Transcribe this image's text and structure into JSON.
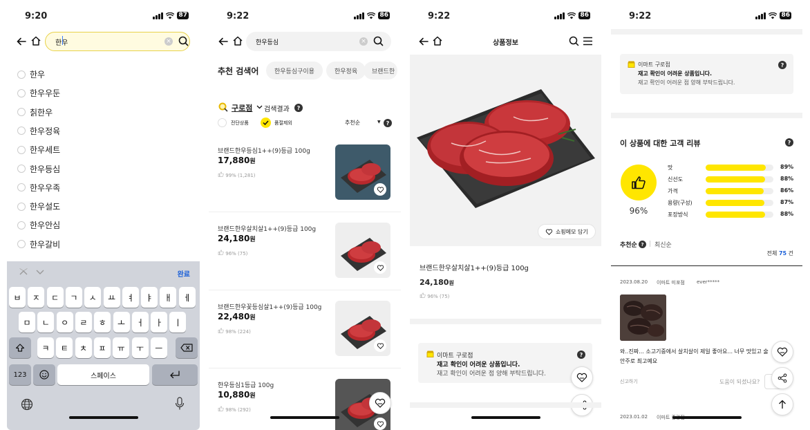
{
  "screens": [
    {
      "status": {
        "time": "9:20",
        "battery": "87"
      },
      "search": {
        "value": "한우"
      },
      "suggestions": [
        "한우",
        "한우우둔",
        "칡한우",
        "한우정육",
        "한우세트",
        "한우등심",
        "한우우족",
        "한우설도",
        "한우안심",
        "한우갈비"
      ],
      "keyboard": {
        "done": "완료",
        "row1": [
          "ㅂ",
          "ㅈ",
          "ㄷ",
          "ㄱ",
          "ㅅ",
          "ㅛ",
          "ㅕ",
          "ㅑ",
          "ㅐ",
          "ㅔ"
        ],
        "row2": [
          "ㅁ",
          "ㄴ",
          "ㅇ",
          "ㄹ",
          "ㅎ",
          "ㅗ",
          "ㅓ",
          "ㅏ",
          "ㅣ"
        ],
        "row3": [
          "ㅋ",
          "ㅌ",
          "ㅊ",
          "ㅍ",
          "ㅠ",
          "ㅜ",
          "ㅡ"
        ],
        "numbers": "123",
        "space": "스페이스"
      }
    },
    {
      "status": {
        "time": "9:22",
        "battery": "86"
      },
      "search": {
        "value": "한우등심"
      },
      "recommend_label": "추천 검색어",
      "recommend_chips": [
        "한우등심구이용",
        "한우정육",
        "브랜드한"
      ],
      "store": "구로점",
      "result_label": "검색결과",
      "filter_exclude_preorder": "전단상품",
      "filter_soldout": "품절제외",
      "sort": "추천순",
      "products": [
        {
          "name": "브랜드한우등심1++(9)등급 100g",
          "price": "17,880",
          "unit": "원",
          "rating": "99% (1,281)"
        },
        {
          "name": "브랜드한우살치살1++(9)등급 100g",
          "price": "24,180",
          "unit": "원",
          "rating": "96% (75)"
        },
        {
          "name": "브랜드한우꽃등심살1++(9)등급 100g",
          "price": "22,480",
          "unit": "원",
          "rating": "98% (224)"
        },
        {
          "name": "한우등심1등급 100g",
          "price": "10,880",
          "unit": "원",
          "rating": "98% (292)"
        }
      ]
    },
    {
      "status": {
        "time": "9:22",
        "battery": "86"
      },
      "header_title": "상품정보",
      "memo_button": "쇼핑메모 담기",
      "product": {
        "name": "브랜드한우살치살1++(9)등급 100g",
        "price": "24,180",
        "unit": "원",
        "rating": "96% (75)"
      },
      "stock": {
        "title": "이마트 구로점",
        "main": "재고 확인이 어려운 상품입니다.",
        "sub": "재고 확인이 어려운 점 양해 부탁드립니다."
      }
    },
    {
      "status": {
        "time": "9:22",
        "battery": "86"
      },
      "stock": {
        "title": "이마트 구로점",
        "main": "재고 확인이 어려운 상품입니다.",
        "sub": "재고 확인이 어려운 점 양해 부탁드립니다."
      },
      "review_title": "이 상품에 대한 고객 리뷰",
      "overall": "96%",
      "ratings": [
        {
          "label": "맛",
          "value": "89%",
          "fraction": 0.89
        },
        {
          "label": "신선도",
          "value": "88%",
          "fraction": 0.88
        },
        {
          "label": "가격",
          "value": "86%",
          "fraction": 0.86
        },
        {
          "label": "용량(구성)",
          "value": "87%",
          "fraction": 0.87
        },
        {
          "label": "포장방식",
          "value": "88%",
          "fraction": 0.88
        }
      ],
      "sort_recommend": "추천순",
      "sort_latest": "최신순",
      "total_prefix": "전체",
      "total_count": "75",
      "total_suffix": "건",
      "review1": {
        "date": "2023.08.20",
        "store": "이마트 미포점",
        "user": "ever*****",
        "text1": "와..진짜... 소고기중에서 살치살이 제일 좋아요... 너무 맛있고 술",
        "text2": "안주로 최고예요",
        "report": "신고하기",
        "helpful": "도움이 되셨나요?"
      },
      "review2": {
        "date": "2023.01.02",
        "store": "이마트 중랑점"
      }
    }
  ]
}
